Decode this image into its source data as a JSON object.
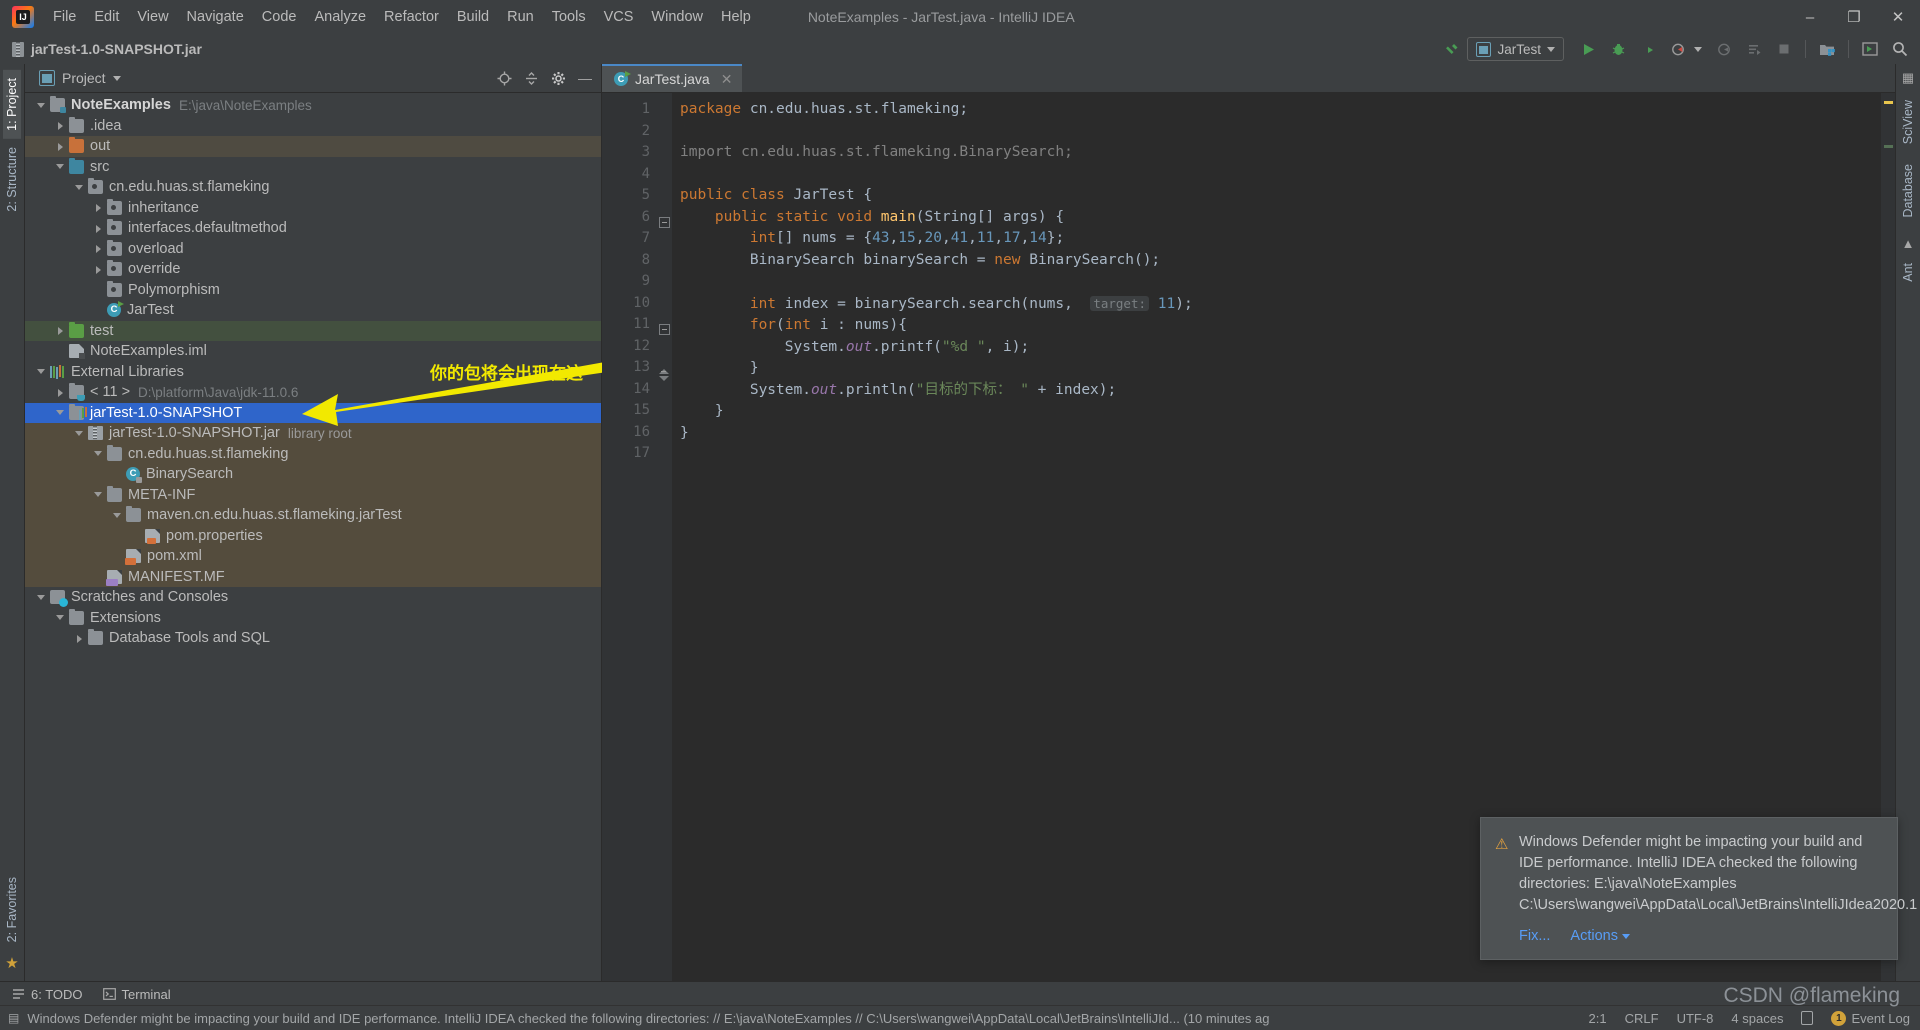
{
  "window": {
    "title": "NoteExamples - JarTest.java - IntelliJ IDEA",
    "minimize_label": "–",
    "maximize_label": "❐",
    "close_label": "✕"
  },
  "menubar": {
    "items": [
      "File",
      "Edit",
      "View",
      "Navigate",
      "Code",
      "Analyze",
      "Refactor",
      "Build",
      "Run",
      "Tools",
      "VCS",
      "Window",
      "Help"
    ]
  },
  "navbar": {
    "breadcrumb": "jarTest-1.0-SNAPSHOT.jar",
    "run_config": "JarTest",
    "buttons": {
      "build": "build-hammer-icon",
      "run": "run-icon",
      "debug": "debug-icon",
      "coverage": "coverage-icon",
      "profile": "profiler-icon",
      "attach": "attach-icon",
      "update": "update-icon",
      "stop": "stop-icon",
      "git": "git-icon",
      "layout": "layout-icon",
      "search": "search-icon"
    }
  },
  "left_strip": {
    "project_tab": "1: Project",
    "structure_tab": "2: Structure",
    "favorites_tab": "2: Favorites"
  },
  "right_strip": {
    "sciview_tab": "SciView",
    "database_tab": "Database",
    "ant_tab": "Ant"
  },
  "project_panel": {
    "title": "Project",
    "actions": [
      "target-icon",
      "collapse-all-icon",
      "settings-gear-icon",
      "hide-icon"
    ],
    "tree": [
      {
        "depth": 0,
        "arrow": "d",
        "icon": "module",
        "label": "NoteExamples",
        "bold": true,
        "sub": "E:\\java\\NoteExamples",
        "hl": ""
      },
      {
        "depth": 1,
        "arrow": "r",
        "icon": "folder",
        "label": ".idea",
        "bold": false,
        "sub": "",
        "hl": ""
      },
      {
        "depth": 1,
        "arrow": "r",
        "icon": "folder-orange",
        "label": "out",
        "bold": false,
        "sub": "",
        "hl": "hl-out"
      },
      {
        "depth": 1,
        "arrow": "d",
        "icon": "folder-blue",
        "label": "src",
        "bold": false,
        "sub": "",
        "hl": ""
      },
      {
        "depth": 2,
        "arrow": "d",
        "icon": "pkg",
        "label": "cn.edu.huas.st.flameking",
        "bold": false,
        "sub": "",
        "hl": ""
      },
      {
        "depth": 3,
        "arrow": "r",
        "icon": "pkg",
        "label": "inheritance",
        "bold": false,
        "sub": "",
        "hl": ""
      },
      {
        "depth": 3,
        "arrow": "r",
        "icon": "pkg",
        "label": "interfaces.defaultmethod",
        "bold": false,
        "sub": "",
        "hl": ""
      },
      {
        "depth": 3,
        "arrow": "r",
        "icon": "pkg",
        "label": "overload",
        "bold": false,
        "sub": "",
        "hl": ""
      },
      {
        "depth": 3,
        "arrow": "r",
        "icon": "pkg",
        "label": "override",
        "bold": false,
        "sub": "",
        "hl": ""
      },
      {
        "depth": 3,
        "arrow": "",
        "icon": "pkg",
        "label": "Polymorphism",
        "bold": false,
        "sub": "",
        "hl": ""
      },
      {
        "depth": 3,
        "arrow": "",
        "icon": "cls-run",
        "label": "JarTest",
        "bold": false,
        "sub": "",
        "hl": ""
      },
      {
        "depth": 1,
        "arrow": "r",
        "icon": "folder-green",
        "label": "test",
        "bold": false,
        "sub": "",
        "hl": "hl-test"
      },
      {
        "depth": 1,
        "arrow": "",
        "icon": "iml",
        "label": "NoteExamples.iml",
        "bold": false,
        "sub": "",
        "hl": ""
      },
      {
        "depth": 0,
        "arrow": "d",
        "icon": "lib",
        "label": "External Libraries",
        "bold": false,
        "sub": "",
        "hl": ""
      },
      {
        "depth": 1,
        "arrow": "r",
        "icon": "jdk",
        "label": "< 11 >",
        "bold": false,
        "sub": "D:\\platform\\Java\\jdk-11.0.6",
        "hl": ""
      },
      {
        "depth": 1,
        "arrow": "d",
        "icon": "jarlib",
        "label": "jarTest-1.0-SNAPSHOT",
        "bold": false,
        "sub": "",
        "hl": "sel"
      },
      {
        "depth": 2,
        "arrow": "d",
        "icon": "jarfile",
        "label": "jarTest-1.0-SNAPSHOT.jar",
        "bold": false,
        "sub": "library root",
        "hl": "hl-jar"
      },
      {
        "depth": 3,
        "arrow": "d",
        "icon": "folder",
        "label": "cn.edu.huas.st.flameking",
        "bold": false,
        "sub": "",
        "hl": "hl-jar"
      },
      {
        "depth": 4,
        "arrow": "",
        "icon": "cls-lock",
        "label": "BinarySearch",
        "bold": false,
        "sub": "",
        "hl": "hl-jar"
      },
      {
        "depth": 3,
        "arrow": "d",
        "icon": "folder",
        "label": "META-INF",
        "bold": false,
        "sub": "",
        "hl": "hl-jar"
      },
      {
        "depth": 4,
        "arrow": "d",
        "icon": "folder",
        "label": "maven.cn.edu.huas.st.flameking.jarTest",
        "bold": false,
        "sub": "",
        "hl": "hl-jar"
      },
      {
        "depth": 5,
        "arrow": "",
        "icon": "props",
        "label": "pom.properties",
        "bold": false,
        "sub": "",
        "hl": "hl-jar"
      },
      {
        "depth": 4,
        "arrow": "",
        "icon": "xml",
        "label": "pom.xml",
        "bold": false,
        "sub": "",
        "hl": "hl-jar"
      },
      {
        "depth": 3,
        "arrow": "",
        "icon": "mf",
        "label": "MANIFEST.MF",
        "bold": false,
        "sub": "",
        "hl": "hl-jar"
      },
      {
        "depth": 0,
        "arrow": "d",
        "icon": "scratch",
        "label": "Scratches and Consoles",
        "bold": false,
        "sub": "",
        "hl": ""
      },
      {
        "depth": 1,
        "arrow": "d",
        "icon": "folder",
        "label": "Extensions",
        "bold": false,
        "sub": "",
        "hl": ""
      },
      {
        "depth": 2,
        "arrow": "r",
        "icon": "folder",
        "label": "Database Tools and SQL",
        "bold": false,
        "sub": "",
        "hl": ""
      }
    ]
  },
  "annotation": {
    "text": "你的包将会出现在这",
    "color": "#f2e900"
  },
  "editor": {
    "tab_label": "JarTest.java",
    "tab_close": "✕",
    "line_numbers": [
      "1",
      "2",
      "3",
      "4",
      "5",
      "6",
      "7",
      "8",
      "9",
      "10",
      "11",
      "12",
      "13",
      "14",
      "15",
      "16",
      "17"
    ],
    "lines": [
      {
        "n": 1,
        "html": "<span class='k'>package</span> cn.edu.huas.st.flameking;"
      },
      {
        "n": 2,
        "html": ""
      },
      {
        "n": 3,
        "html": "<span class='cmt'>import cn.edu.huas.st.flameking.BinarySearch;</span>"
      },
      {
        "n": 4,
        "html": ""
      },
      {
        "n": 5,
        "html": "<span class='k'>public class</span> JarTest {"
      },
      {
        "n": 6,
        "html": "    <span class='k'>public static void</span> <span class='f'>main</span>(String[] args) {"
      },
      {
        "n": 7,
        "html": "        <span class='k'>int</span>[] nums = {<span class='n'>43</span>,<span class='n'>15</span>,<span class='n'>20</span>,<span class='n'>41</span>,<span class='n'>11</span>,<span class='n'>17</span>,<span class='n'>14</span>};"
      },
      {
        "n": 8,
        "html": "        BinarySearch binarySearch = <span class='k'>new</span> BinarySearch();"
      },
      {
        "n": 9,
        "html": ""
      },
      {
        "n": 10,
        "html": "        <span class='k'>int</span> index = binarySearch.search(nums,  <span class='hint'>target:</span> <span class='n'>11</span>);"
      },
      {
        "n": 11,
        "html": "        <span class='k'>for</span>(<span class='k'>int</span> i : nums){"
      },
      {
        "n": 12,
        "html": "            System.<span class='st'>out</span>.printf(<span class='s'>\"%d \"</span>, i);"
      },
      {
        "n": 13,
        "html": "        }"
      },
      {
        "n": 14,
        "html": "        System.<span class='st'>out</span>.println(<span class='s'>\"目标的下标： \"</span> + index);"
      },
      {
        "n": 15,
        "html": "    }"
      },
      {
        "n": 16,
        "html": "}"
      },
      {
        "n": 17,
        "html": ""
      }
    ],
    "run_marker_lines": [
      5,
      6
    ]
  },
  "notification": {
    "icon": "warning-icon",
    "message": "Windows Defender might be impacting your build and IDE performance. IntelliJ IDEA checked the following directories: E:\\java\\NoteExamples C:\\Users\\wangwei\\AppData\\Local\\JetBrains\\IntelliJIdea2020.1",
    "fix_label": "Fix...",
    "actions_label": "Actions"
  },
  "bottom_bar": {
    "todo": "6: TODO",
    "terminal": "Terminal"
  },
  "status_bar": {
    "message": "Windows Defender might be impacting your build and IDE performance. IntelliJ IDEA checked the following directories: // E:\\java\\NoteExamples // C:\\Users\\wangwei\\AppData\\Local\\JetBrains\\IntelliJId... (10 minutes ag",
    "caret": "2:1",
    "line_sep": "CRLF",
    "encoding": "UTF-8",
    "indent": "4 spaces",
    "event_log": "Event Log",
    "event_count": "1"
  },
  "watermark": "CSDN @flameking"
}
